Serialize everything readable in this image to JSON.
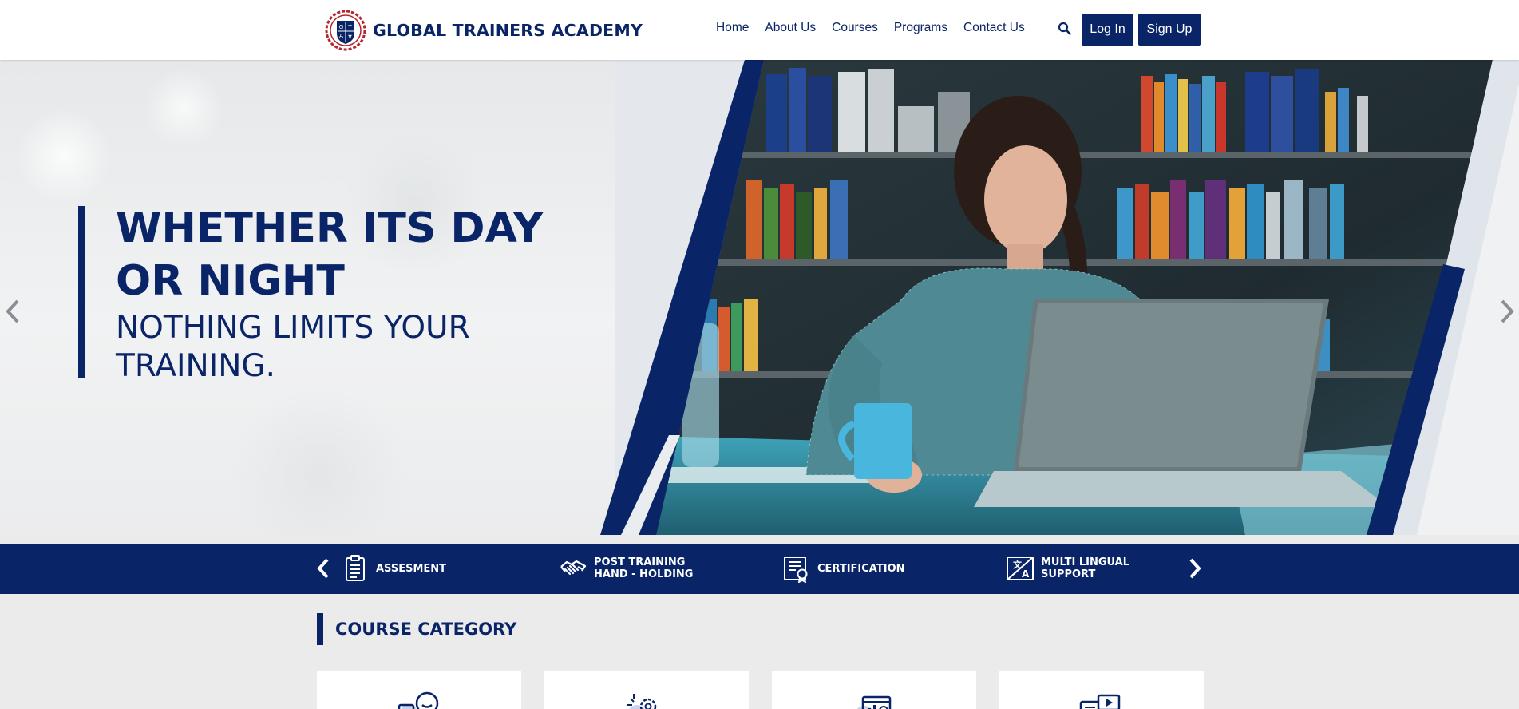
{
  "brand": {
    "name": "GLOBAL TRAINERS ACADEMY",
    "emblem_initials": [
      "G",
      "T",
      "A",
      "★"
    ]
  },
  "nav": {
    "items": [
      "Home",
      "About Us",
      "Courses",
      "Programs",
      "Contact Us"
    ],
    "login_label": "Log In",
    "signup_label": "Sign Up"
  },
  "hero": {
    "title_line1": "WHETHER ITS DAY",
    "title_line2": "OR NIGHT",
    "subtitle_line1": "NOTHING LIMITS YOUR",
    "subtitle_line2": "TRAINING."
  },
  "features": [
    {
      "label": "ASSESMENT",
      "icon": "clipboard-icon"
    },
    {
      "label": "POST TRAINING\nHAND - HOLDING",
      "icon": "handshake-icon"
    },
    {
      "label": "CERTIFICATION",
      "icon": "certificate-icon"
    },
    {
      "label": "MULTI LINGUAL\nSUPPORT",
      "icon": "translate-icon"
    }
  ],
  "course_category": {
    "title": "COURSE CATEGORY",
    "cards": [
      {
        "icon": "chat-bubbles-icon"
      },
      {
        "icon": "gears-icon"
      },
      {
        "icon": "presentation-chart-icon"
      },
      {
        "icon": "video-play-icon"
      }
    ]
  },
  "colors": {
    "brand_navy": "#0a2468",
    "header_bg": "#ffffff",
    "page_bg": "#ebebeb",
    "logo_red": "#b3272d"
  }
}
